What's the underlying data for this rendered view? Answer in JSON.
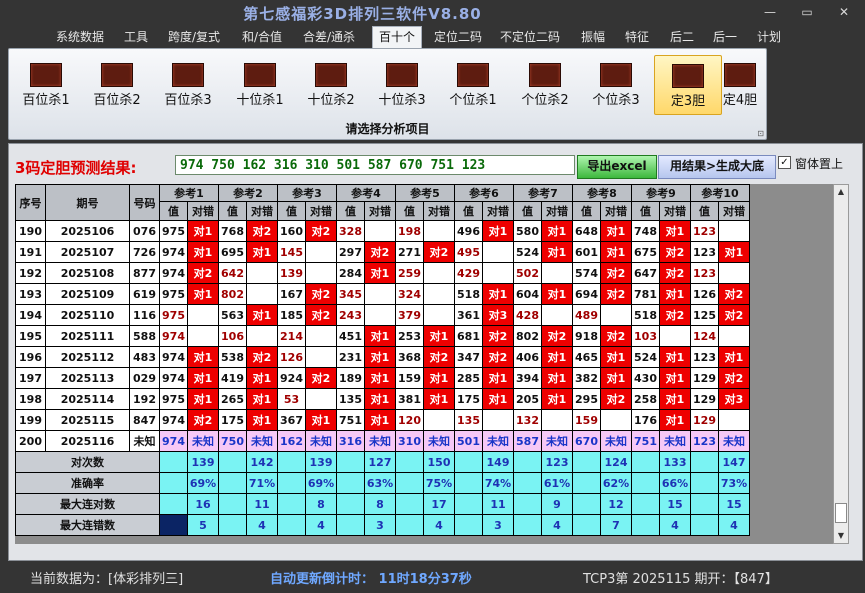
{
  "window": {
    "title": "第七感福彩3D排列三软件V8.80",
    "min": "—",
    "max": "▭",
    "close": "✕"
  },
  "menu": [
    {
      "label": "系统数据"
    },
    {
      "label": "工具"
    },
    {
      "label": "跨度/复式"
    },
    {
      "label": "和/合值"
    },
    {
      "label": "合差/通杀"
    },
    {
      "label": "百十个",
      "active": true
    },
    {
      "label": "定位二码"
    },
    {
      "label": "不定位二码"
    },
    {
      "label": "振幅"
    },
    {
      "label": "特征"
    },
    {
      "label": "后二"
    },
    {
      "label": "后一"
    },
    {
      "label": "计划"
    }
  ],
  "ribbon": {
    "buttons": [
      {
        "label": "百位杀1",
        "icon": "chart-icon"
      },
      {
        "label": "百位杀2",
        "icon": "chart-icon"
      },
      {
        "label": "百位杀3",
        "icon": "chart-icon"
      },
      {
        "label": "十位杀1",
        "icon": "chart-icon"
      },
      {
        "label": "十位杀2",
        "icon": "chart-icon"
      },
      {
        "label": "十位杀3",
        "icon": "chart-icon"
      },
      {
        "label": "个位杀1",
        "icon": "chart-icon"
      },
      {
        "label": "个位杀2",
        "icon": "chart-icon"
      },
      {
        "label": "个位杀3",
        "icon": "chart-icon"
      },
      {
        "label": "定3胆",
        "icon": "chart-icon",
        "selected": true
      },
      {
        "label": "定4胆",
        "icon": "chart-icon"
      }
    ],
    "footer": "请选择分析项目",
    "corner": "⊡"
  },
  "prediction": {
    "label": "3码定胆预测结果:",
    "value": "974 750 162 316 310 501 587 670 751 123",
    "excel_button": "导出excel",
    "generate_button": "用结果>生成大底",
    "checkbox_label": "窗体置上",
    "checkbox_checked": "✓"
  },
  "grid": {
    "headers": {
      "index": "序号",
      "date": "期号",
      "number": "号码",
      "value": "值",
      "result": "对错"
    },
    "refs": [
      "参考1",
      "参考2",
      "参考3",
      "参考4",
      "参考5",
      "参考6",
      "参考7",
      "参考8",
      "参考9",
      "参考10"
    ],
    "rows": [
      {
        "index": "190",
        "date": "2025106",
        "number": "076",
        "cells": [
          [
            "975",
            "对1"
          ],
          [
            "768",
            "对2"
          ],
          [
            "160",
            "对2"
          ],
          [
            "328",
            ""
          ],
          [
            "198",
            ""
          ],
          [
            "496",
            "对1"
          ],
          [
            "580",
            "对1"
          ],
          [
            "648",
            "对1"
          ],
          [
            "748",
            "对1"
          ],
          [
            "123",
            ""
          ]
        ]
      },
      {
        "index": "191",
        "date": "2025107",
        "number": "726",
        "cells": [
          [
            "974",
            "对1"
          ],
          [
            "695",
            "对1"
          ],
          [
            "145",
            ""
          ],
          [
            "297",
            "对2"
          ],
          [
            "271",
            "对2"
          ],
          [
            "495",
            ""
          ],
          [
            "524",
            "对1"
          ],
          [
            "601",
            "对1"
          ],
          [
            "675",
            "对2"
          ],
          [
            "123",
            "对1"
          ]
        ]
      },
      {
        "index": "192",
        "date": "2025108",
        "number": "877",
        "cells": [
          [
            "974",
            "对2"
          ],
          [
            "642",
            ""
          ],
          [
            "139",
            ""
          ],
          [
            "284",
            "对1"
          ],
          [
            "259",
            ""
          ],
          [
            "429",
            ""
          ],
          [
            "502",
            ""
          ],
          [
            "574",
            "对2"
          ],
          [
            "647",
            "对2"
          ],
          [
            "123",
            ""
          ]
        ]
      },
      {
        "index": "193",
        "date": "2025109",
        "number": "619",
        "cells": [
          [
            "975",
            "对1"
          ],
          [
            "802",
            ""
          ],
          [
            "167",
            "对2"
          ],
          [
            "345",
            ""
          ],
          [
            "324",
            ""
          ],
          [
            "518",
            "对1"
          ],
          [
            "604",
            "对1"
          ],
          [
            "694",
            "对2"
          ],
          [
            "781",
            "对1"
          ],
          [
            "126",
            "对2"
          ]
        ]
      },
      {
        "index": "194",
        "date": "2025110",
        "number": "116",
        "cells": [
          [
            "975",
            ""
          ],
          [
            "563",
            "对1"
          ],
          [
            "185",
            "对2"
          ],
          [
            "243",
            ""
          ],
          [
            "379",
            ""
          ],
          [
            "361",
            "对3"
          ],
          [
            "428",
            ""
          ],
          [
            "489",
            ""
          ],
          [
            "518",
            "对2"
          ],
          [
            "125",
            "对2"
          ]
        ]
      },
      {
        "index": "195",
        "date": "2025111",
        "number": "588",
        "cells": [
          [
            "974",
            ""
          ],
          [
            "106",
            ""
          ],
          [
            "214",
            ""
          ],
          [
            "451",
            "对1"
          ],
          [
            "253",
            "对1"
          ],
          [
            "681",
            "对2"
          ],
          [
            "802",
            "对2"
          ],
          [
            "918",
            "对2"
          ],
          [
            "103",
            ""
          ],
          [
            "124",
            ""
          ]
        ]
      },
      {
        "index": "196",
        "date": "2025112",
        "number": "483",
        "cells": [
          [
            "974",
            "对1"
          ],
          [
            "538",
            "对2"
          ],
          [
            "126",
            ""
          ],
          [
            "231",
            "对1"
          ],
          [
            "368",
            "对2"
          ],
          [
            "347",
            "对2"
          ],
          [
            "406",
            "对1"
          ],
          [
            "465",
            "对1"
          ],
          [
            "524",
            "对1"
          ],
          [
            "123",
            "对1"
          ]
        ]
      },
      {
        "index": "197",
        "date": "2025113",
        "number": "029",
        "cells": [
          [
            "974",
            "对1"
          ],
          [
            "419",
            "对1"
          ],
          [
            "924",
            "对2"
          ],
          [
            "189",
            "对1"
          ],
          [
            "159",
            "对1"
          ],
          [
            "285",
            "对1"
          ],
          [
            "394",
            "对1"
          ],
          [
            "382",
            "对1"
          ],
          [
            "430",
            "对1"
          ],
          [
            "129",
            "对2"
          ]
        ]
      },
      {
        "index": "198",
        "date": "2025114",
        "number": "192",
        "cells": [
          [
            "975",
            "对1"
          ],
          [
            "265",
            "对1"
          ],
          [
            "53",
            ""
          ],
          [
            "135",
            "对1"
          ],
          [
            "381",
            "对1"
          ],
          [
            "175",
            "对1"
          ],
          [
            "205",
            "对1"
          ],
          [
            "295",
            "对2"
          ],
          [
            "258",
            "对1"
          ],
          [
            "129",
            "对3"
          ]
        ]
      },
      {
        "index": "199",
        "date": "2025115",
        "number": "847",
        "cells": [
          [
            "974",
            "对2"
          ],
          [
            "175",
            "对1"
          ],
          [
            "367",
            "对1"
          ],
          [
            "751",
            "对1"
          ],
          [
            "120",
            ""
          ],
          [
            "135",
            ""
          ],
          [
            "132",
            ""
          ],
          [
            "159",
            ""
          ],
          [
            "176",
            "对1"
          ],
          [
            "129",
            ""
          ]
        ]
      },
      {
        "index": "200",
        "date": "2025116",
        "number": "未知",
        "unknown": true,
        "cells": [
          [
            "974",
            "未知"
          ],
          [
            "750",
            "未知"
          ],
          [
            "162",
            "未知"
          ],
          [
            "316",
            "未知"
          ],
          [
            "310",
            "未知"
          ],
          [
            "501",
            "未知"
          ],
          [
            "587",
            "未知"
          ],
          [
            "670",
            "未知"
          ],
          [
            "751",
            "未知"
          ],
          [
            "123",
            "未知"
          ]
        ]
      }
    ],
    "stats": [
      {
        "label": "对次数",
        "values": [
          "139",
          "142",
          "139",
          "127",
          "150",
          "149",
          "123",
          "124",
          "133",
          "147"
        ]
      },
      {
        "label": "准确率",
        "values": [
          "69%",
          "71%",
          "69%",
          "63%",
          "75%",
          "74%",
          "61%",
          "62%",
          "66%",
          "73%"
        ]
      },
      {
        "label": "最大连对数",
        "values": [
          "16",
          "11",
          "8",
          "8",
          "17",
          "11",
          "9",
          "12",
          "15",
          "15"
        ]
      },
      {
        "label": "最大连错数",
        "values": [
          "5",
          "4",
          "4",
          "3",
          "4",
          "3",
          "4",
          "7",
          "4",
          "4"
        ]
      }
    ]
  },
  "scrollbar": {
    "up": "▲",
    "down": "▼"
  },
  "status": {
    "source": "当前数据为：[体彩排列三]",
    "countdown": "自动更新倒计时： 11时18分37秒",
    "draw": "TCP3第 2025115 期开：【847】"
  }
}
